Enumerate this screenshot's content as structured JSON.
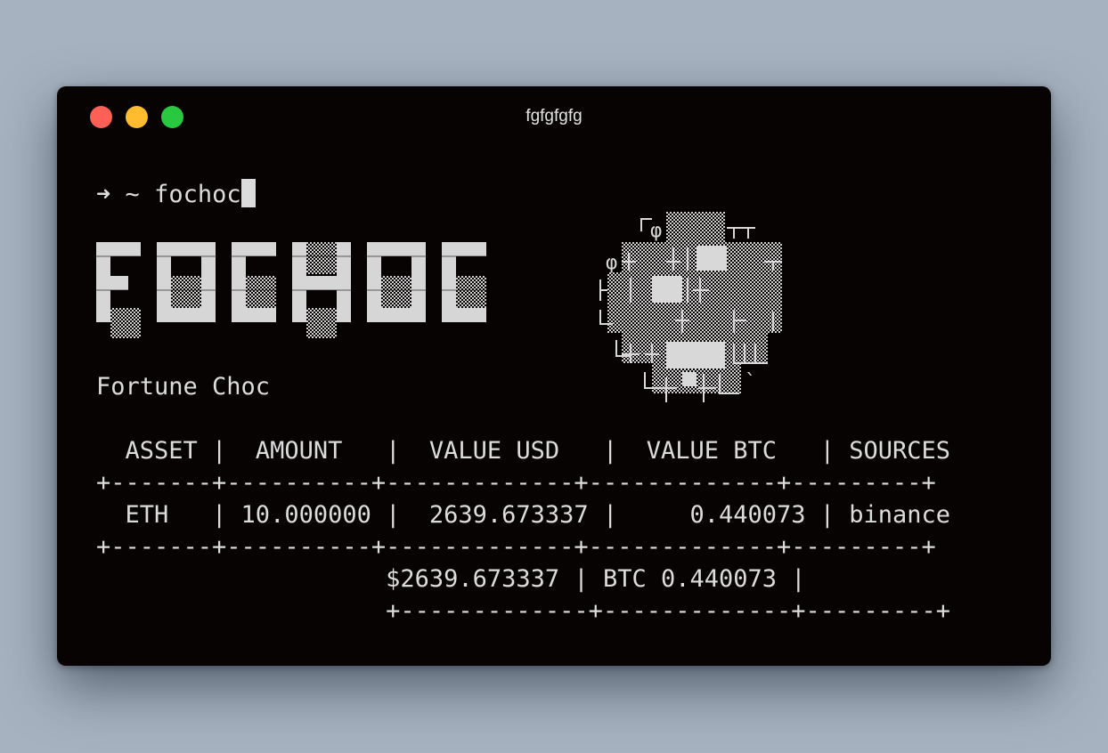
{
  "window": {
    "title": "fgfgfgfg"
  },
  "prompt": {
    "arrow": "➜",
    "cwd": "~",
    "command": "fochoc"
  },
  "banner": {
    "subtitle": "Fortune Choc"
  },
  "table": {
    "header": "  ASSET |  AMOUNT   |  VALUE USD   |  VALUE BTC   | SOURCES",
    "separator": "+-------+----------+-------------+-------------+---------+",
    "row": "  ETH   | 10.000000 |  2639.673337 |     0.440073 | binance",
    "total": "                    $2639.673337 | BTC 0.440073 |",
    "total_separator": "                    +-------------+-------------+---------+"
  },
  "colors": {
    "background": "#a6b2c0",
    "terminal_bg": "#070302",
    "text": "#dcdcdc",
    "close": "#fe5f57",
    "minimize": "#febc2e",
    "maximize": "#28c840"
  }
}
